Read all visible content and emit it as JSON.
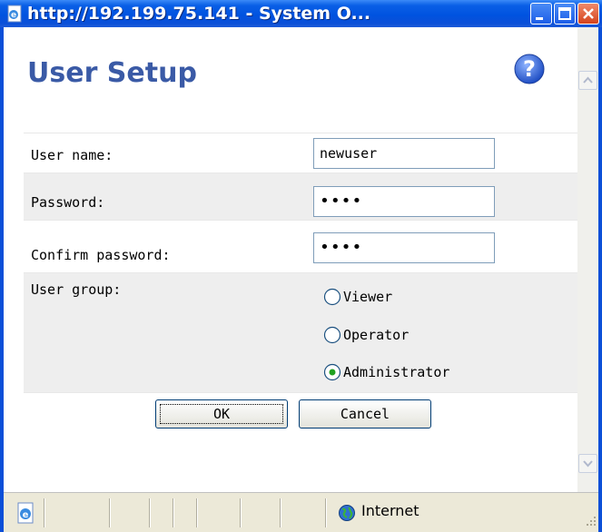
{
  "window": {
    "title": "http://192.199.75.141 - System O..."
  },
  "form": {
    "title": "User Setup",
    "fields": {
      "user_name": {
        "label": "User name:",
        "value": "newuser"
      },
      "password": {
        "label": "Password:",
        "value": "••••"
      },
      "confirm_password": {
        "label": "Confirm password:",
        "value": "••••"
      }
    },
    "user_group": {
      "label": "User group:",
      "options": [
        "Viewer",
        "Operator",
        "Administrator"
      ],
      "selected": "Administrator"
    },
    "buttons": {
      "ok": "OK",
      "cancel": "Cancel"
    }
  },
  "statusbar": {
    "zone": "Internet"
  },
  "icons": {
    "help": "help-icon",
    "browser": "ie-icon",
    "zone": "globe-icon"
  },
  "colors": {
    "title_bar": "#0053e0",
    "heading": "#3a5aa6",
    "close_button": "#d5431c"
  }
}
